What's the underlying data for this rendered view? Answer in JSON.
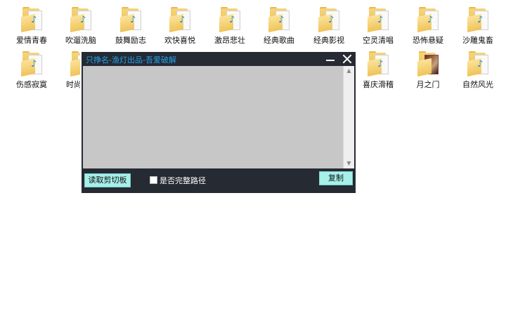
{
  "desktop": {
    "row1": [
      {
        "label": "爱情青春"
      },
      {
        "label": "吹遛洗脑"
      },
      {
        "label": "鼓舞励志"
      },
      {
        "label": "欢快喜悦"
      },
      {
        "label": "激昂悲壮"
      },
      {
        "label": "经典歌曲"
      },
      {
        "label": "经典影视"
      },
      {
        "label": "空灵清唱"
      },
      {
        "label": "恐怖悬疑"
      },
      {
        "label": "沙雕鬼畜"
      }
    ],
    "row2": [
      {
        "label": "伤感寂寞"
      },
      {
        "label": "时尚"
      },
      {
        "label": "喜庆滑稽"
      },
      {
        "label": "月之门"
      },
      {
        "label": "自然风光"
      }
    ]
  },
  "window": {
    "title": "只挣名-渔灯出品-吾爱破解",
    "read_clipboard_label": "读取剪切板",
    "full_path_label": "是否完整路径",
    "copy_label": "复制"
  },
  "colors": {
    "window_bg": "#262a33",
    "title_text": "#22a3ea",
    "button_bg": "#a6f0ea",
    "textarea_bg": "#c7c7c7"
  }
}
